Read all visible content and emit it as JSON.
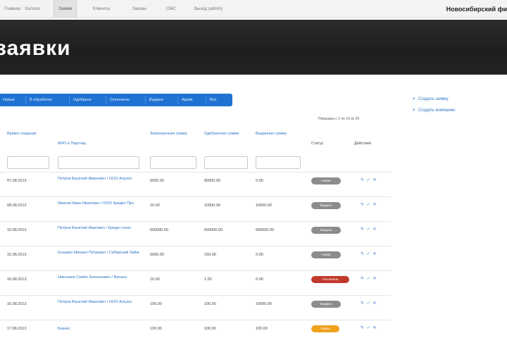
{
  "topnav": {
    "items": [
      {
        "label": "Главная",
        "active": false
      },
      {
        "label": "Каталог",
        "active": false
      },
      {
        "label": "Заявки",
        "active": true
      },
      {
        "label": "Клиенты",
        "active": false
      },
      {
        "label": "Заказы",
        "active": false
      },
      {
        "label": "СМС",
        "active": false
      },
      {
        "label": "Выход (admin)",
        "active": false
      }
    ],
    "company": "Новосибирский фи"
  },
  "header": {
    "title": "заявки"
  },
  "tabs": [
    "Новые",
    "В обработке",
    "Одобрено",
    "Отклонено",
    "Выдано",
    "Архив",
    "Все"
  ],
  "pager": "Показаны с 1 по 10 из 29",
  "sidebar": {
    "links": [
      "Создать заявку",
      "Создать компанию"
    ]
  },
  "table": {
    "headers": {
      "date": "Время создания",
      "client": "ФИО и Партнер",
      "requested": "Запрошенная сумма",
      "approved": "Одобренная сумма",
      "issued": "Выданная сумма",
      "status": "Статус",
      "actions": "Действия"
    },
    "rows": [
      {
        "date": "07.08.2013",
        "client": "Петров Василий Иванович / ООО Альянс",
        "requested": "5000.00",
        "approved": "80000.00",
        "issued": "0.00",
        "status": "Новая",
        "status_color": "#8c8c8c",
        "actions": "✎ ✓ ✕"
      },
      {
        "date": "08.08.2013",
        "client": "Иванов Иван Иванович / ООО Кредит Про",
        "requested": "10.00",
        "approved": "10000.00",
        "issued": "10000.00",
        "status": "Выдано",
        "status_color": "#8c8c8c",
        "actions": "✎ ✓ ✕"
      },
      {
        "date": "15.08.2013",
        "client": "Петров Василий Ивагович / Кредит плюс",
        "requested": "600000.00",
        "approved": "600000.00",
        "issued": "580000.00",
        "status": "Выдано",
        "status_color": "#8c8c8c",
        "actions": "✎ ✓ ✕"
      },
      {
        "date": "15.08.2013",
        "client": "Кузьмин Михаил Петрович / Сибирский Займ",
        "requested": "5000.00",
        "approved": "150.00",
        "issued": "0.00",
        "status": "Новая",
        "status_color": "#8c8c8c",
        "actions": "✎ ✓ ✕"
      },
      {
        "date": "16.08.2013",
        "client": "Николаев Семён Алексеевич / Финанс",
        "requested": "10.00",
        "approved": "1.00",
        "issued": "0.00",
        "status": "Отклонена",
        "status_color": "#c0392b",
        "actions": "✎ ✓ ✕"
      },
      {
        "date": "16.08.2013",
        "client": "Петров Василий Иванович / ООО Альянс",
        "requested": "100.00",
        "approved": "100.00",
        "issued": "10000.00",
        "status": "Выдано",
        "status_color": "#8c8c8c",
        "actions": "✎ ✓ ✕"
      },
      {
        "date": "17.08.2013",
        "client": "Бизнес",
        "requested": "100.00",
        "approved": "100.00",
        "issued": "100.00",
        "status": "Новая",
        "status_color": "#f0a21c",
        "actions": "✎ ✓ ✕"
      }
    ]
  },
  "colors": {
    "header_bg": "#242424",
    "tab_bar": "#1f72d2",
    "link": "#2f74c6",
    "badge_gray": "#8c8c8c",
    "badge_red": "#c0392b",
    "badge_orange": "#f0a21c"
  }
}
